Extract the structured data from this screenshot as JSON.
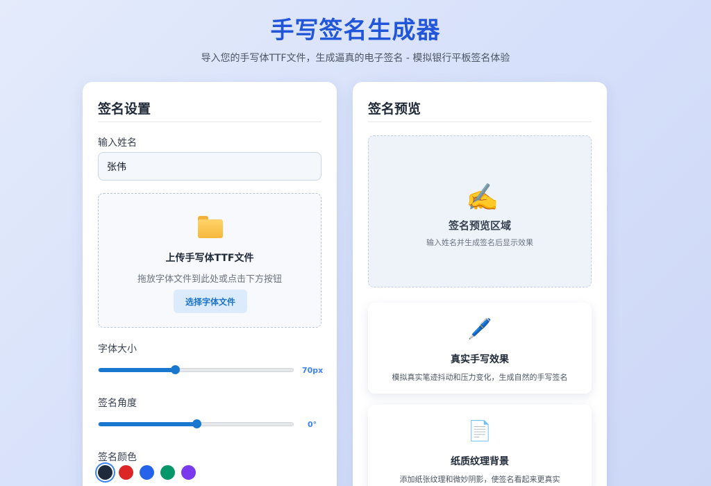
{
  "header": {
    "title": "手写签名生成器",
    "subtitle": "导入您的手写体TTF文件，生成逼真的电子签名 - 模拟银行平板签名体验"
  },
  "settings": {
    "title": "签名设置",
    "name_label": "输入姓名",
    "name_value": "张伟",
    "upload": {
      "icon": "folder-icon",
      "title": "上传手写体TTF文件",
      "hint": "拖放字体文件到此处或点击下方按钮",
      "button_label": "选择字体文件"
    },
    "font_size": {
      "label": "字体大小",
      "value_text": "70px",
      "fraction": 0.39
    },
    "angle": {
      "label": "签名角度",
      "value_text": "0°",
      "fraction": 0.5
    },
    "color": {
      "label": "签名颜色",
      "swatches": [
        "#1e293b",
        "#dc2626",
        "#2563eb",
        "#059669",
        "#7c3aed"
      ],
      "selected_index": 0
    }
  },
  "preview": {
    "title": "签名预览",
    "area": {
      "icon": "writing-hand-icon",
      "emoji": "✍️",
      "title": "签名预览区域",
      "hint": "输入姓名并生成签名后显示效果"
    },
    "features": [
      {
        "icon": "pen-icon",
        "emoji": "🖊️",
        "title": "真实手写效果",
        "desc": "模拟真实笔迹抖动和压力变化，生成自然的手写签名"
      },
      {
        "icon": "paper-icon",
        "emoji": "📄",
        "title": "纸质纹理背景",
        "desc": "添加纸张纹理和微妙阴影，使签名看起来更真实"
      }
    ]
  }
}
